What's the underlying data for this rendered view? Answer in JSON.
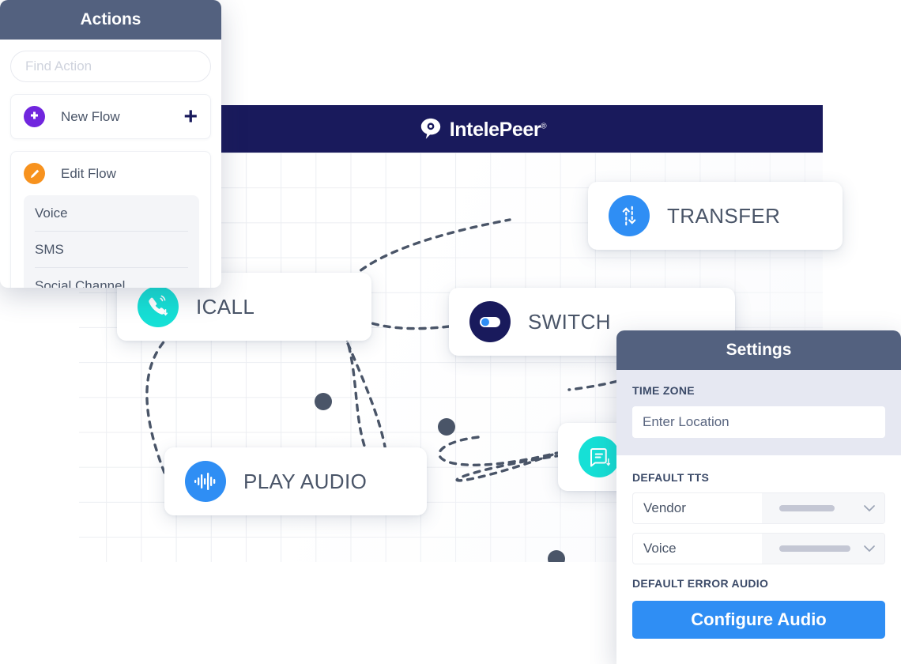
{
  "actions_panel": {
    "title": "Actions",
    "search": {
      "placeholder": "Find Action",
      "value": ""
    },
    "new_flow": {
      "label": "New Flow",
      "icon": "plus-circle-icon",
      "add_button": "+"
    },
    "edit_flow": {
      "label": "Edit Flow",
      "icon": "pencil-icon",
      "channels": [
        {
          "label": "Voice"
        },
        {
          "label": "SMS"
        },
        {
          "label": "Social Channel"
        }
      ]
    }
  },
  "header": {
    "brand": "IntelePeer",
    "registered_mark": "®",
    "logo_icon": "intelepeer-speech-bubble-logo",
    "background": "#191a5c"
  },
  "canvas": {
    "nodes": [
      {
        "id": "transfer",
        "label": "TRANSFER",
        "icon": "transfer-arrows-icon",
        "color": "#2f8ef4"
      },
      {
        "id": "switch",
        "label": "SWITCH",
        "icon": "toggle-switch-icon",
        "color": "#191a5c"
      },
      {
        "id": "icall",
        "label": "ICALL",
        "icon": "incoming-call-icon",
        "color": "#16e0d6"
      },
      {
        "id": "play_audio",
        "label": "PLAY AUDIO",
        "icon": "audio-waveform-icon",
        "color": "#2f8ef4"
      },
      {
        "id": "message",
        "label": "",
        "icon": "message-document-icon",
        "color": "#16e0d6"
      }
    ],
    "connector_color": "#4a5568"
  },
  "settings_panel": {
    "title": "Settings",
    "time_zone": {
      "section_label": "TIME ZONE",
      "placeholder": "Enter Location",
      "value": ""
    },
    "default_tts": {
      "section_label": "DEFAULT TTS",
      "rows": [
        {
          "label": "Vendor",
          "value": "",
          "bar_width": "58%"
        },
        {
          "label": "Voice",
          "value": "",
          "bar_width": "74%"
        }
      ]
    },
    "default_error_audio": {
      "section_label": "DEFAULT ERROR AUDIO",
      "button_label": "Configure Audio",
      "button_color": "#2f8ef4"
    }
  }
}
